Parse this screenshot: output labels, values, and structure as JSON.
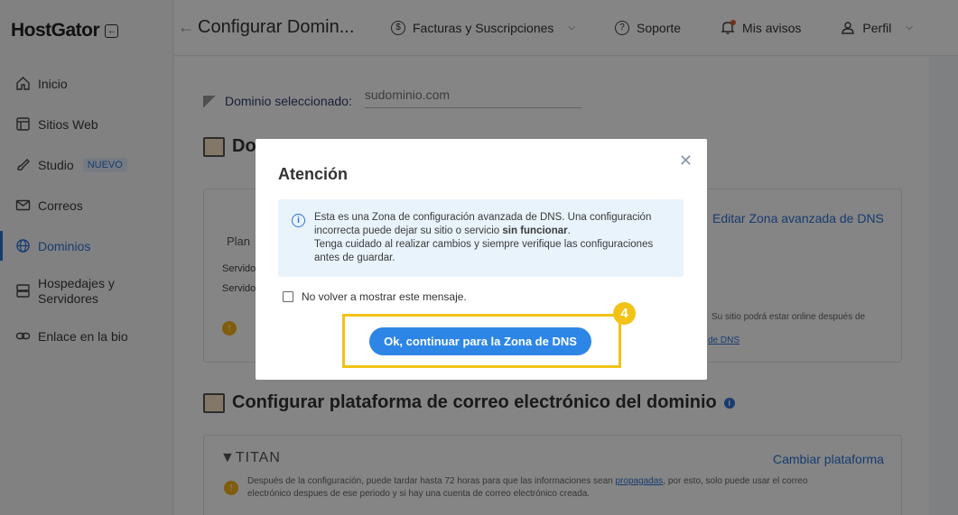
{
  "sidebar": {
    "logo": "HostGator",
    "items": [
      {
        "label": "Inicio",
        "icon": "home-icon"
      },
      {
        "label": "Sitios Web",
        "icon": "window-icon"
      },
      {
        "label": "Studio",
        "badge": "NUEVO",
        "icon": "brush-icon"
      },
      {
        "label": "Correos",
        "icon": "mail-icon"
      },
      {
        "label": "Dominios",
        "icon": "globe-icon",
        "active": true
      },
      {
        "label": "Hospedajes y Servidores",
        "icon": "server-icon"
      },
      {
        "label": "Enlace en la bio",
        "icon": "link-icon"
      }
    ]
  },
  "topbar": {
    "title": "Configurar Domin...",
    "links": {
      "billing": "Facturas y Suscripciones",
      "support": "Soporte",
      "notices": "Mis avisos",
      "profile": "Perfil"
    }
  },
  "main": {
    "domain_label": "Dominio seleccionado:",
    "domain_value": "sudominio.com",
    "dns_section_title": "Do",
    "plan_text": "Plan",
    "server_1": "Servido",
    "server_2": "Servido",
    "edit_dns_link": "Editar Zona avanzada de DNS",
    "online_note": "Su sitio podrá estar online después de",
    "dns_link": "de DNS",
    "email_section_title": "Configurar plataforma de correo electrónico del dominio",
    "titan_logo": "TITAN",
    "change_platform_link": "Cambiar plataforma",
    "titan_note_1": "Después de la configuración, puede tardar hasta 72 horas para que las informaciones sean",
    "titan_note_link": "propagadas",
    "titan_note_2": ", por esto, solo puede usar el correo",
    "titan_note_3": "electrónico despues de ese periodo y si hay una cuenta de correo electrónico creada."
  },
  "modal": {
    "title": "Atención",
    "alert_part1": "Esta es una Zona de configuración avanzada de DNS. Una configuración incorrecta puede dejar su sitio o servicio ",
    "alert_bold": "sin funcionar",
    "alert_part2": ".",
    "alert_line2": "Tenga cuidado al realizar cambios y siempre verifique las configuraciones antes de guardar.",
    "checkbox_label": "No volver a mostrar este mensaje.",
    "button_label": "Ok, continuar para la Zona de DNS",
    "close_symbol": "✕"
  },
  "annotation": {
    "step_number": "4",
    "color": "#f2c316"
  },
  "colors": {
    "accent": "#2d73d6",
    "button": "#2d86e5",
    "alert_bg": "#e8f3fc",
    "warning": "#f5b21a"
  }
}
